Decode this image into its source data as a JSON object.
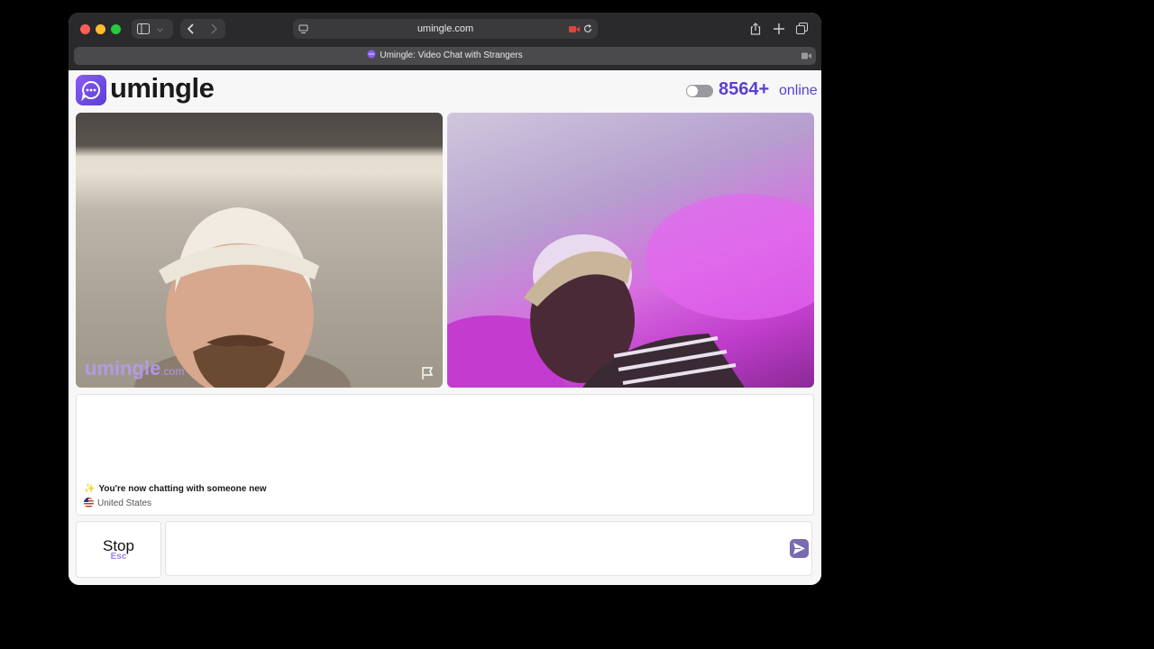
{
  "browser": {
    "url": "umingle.com",
    "tab_title": "Umingle: Video Chat with Strangers"
  },
  "header": {
    "logo_text": "umingle",
    "online_count": "8564+",
    "online_label": "online"
  },
  "video": {
    "watermark": "umingle",
    "watermark_suffix": ".com"
  },
  "chat": {
    "system_message": "You're now chatting with someone new",
    "country": "United States"
  },
  "controls": {
    "stop_label": "Stop",
    "stop_shortcut": "Esc",
    "message_placeholder": ""
  },
  "colors": {
    "brand": "#5b3fd1",
    "send_button": "#7a6ab0"
  }
}
